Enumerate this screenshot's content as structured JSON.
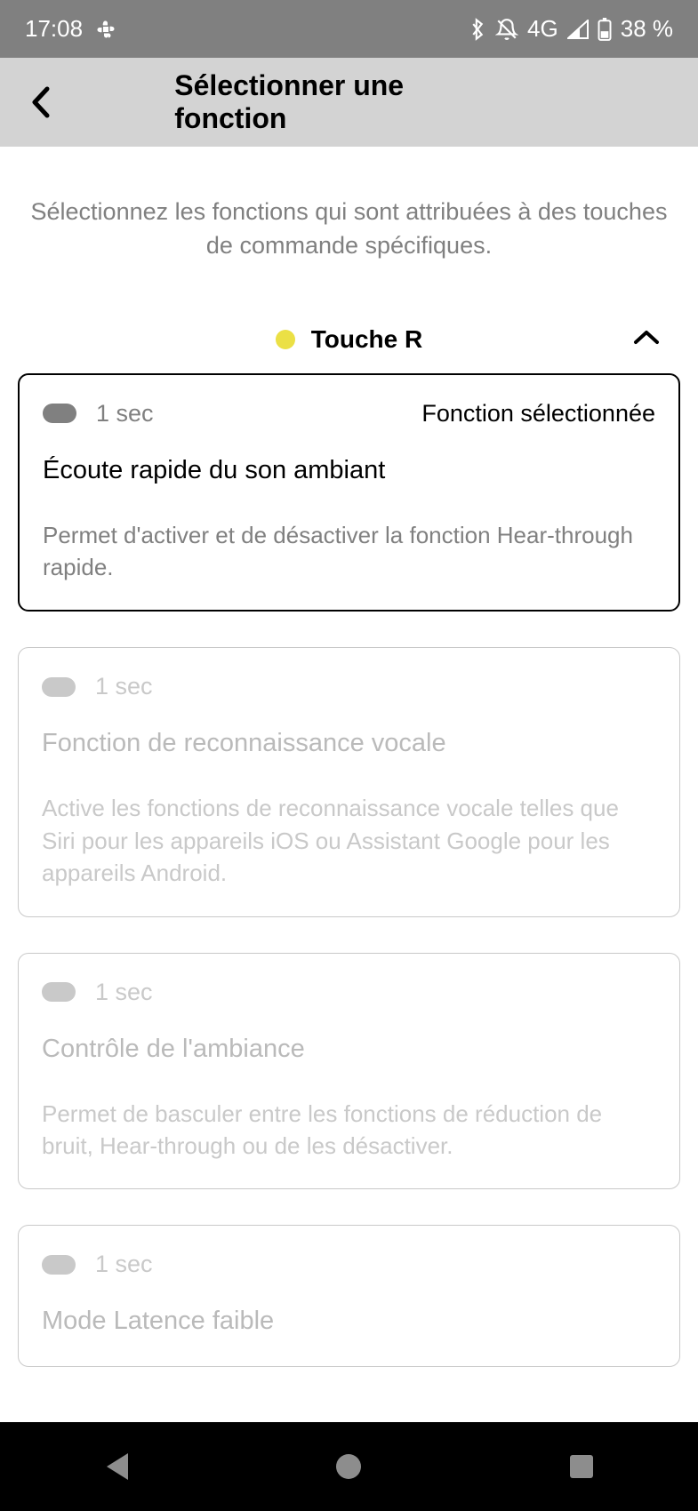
{
  "status": {
    "time": "17:08",
    "network": "4G",
    "battery": "38 %"
  },
  "header": {
    "title": "Sélectionner une fonction"
  },
  "intro": "Sélectionnez les fonctions qui sont attribuées à des touches de commande spécifiques.",
  "section": {
    "title": "Touche R"
  },
  "selected_label": "Fonction sélectionnée",
  "cards": [
    {
      "duration": "1 sec",
      "title": "Écoute rapide du son ambiant",
      "desc": "Permet d'activer et de désactiver la fonction Hear-through rapide.",
      "selected": true
    },
    {
      "duration": "1 sec",
      "title": "Fonction de reconnaissance vocale",
      "desc": "Active les fonctions de reconnaissance vocale telles que Siri pour les appareils iOS ou Assistant Google pour les appareils Android.",
      "selected": false
    },
    {
      "duration": "1 sec",
      "title": "Contrôle de l'ambiance",
      "desc": "Permet de basculer entre les fonctions de réduction de bruit, Hear-through ou de les désactiver.",
      "selected": false
    },
    {
      "duration": "1 sec",
      "title": "Mode Latence faible",
      "desc": "",
      "selected": false
    }
  ]
}
